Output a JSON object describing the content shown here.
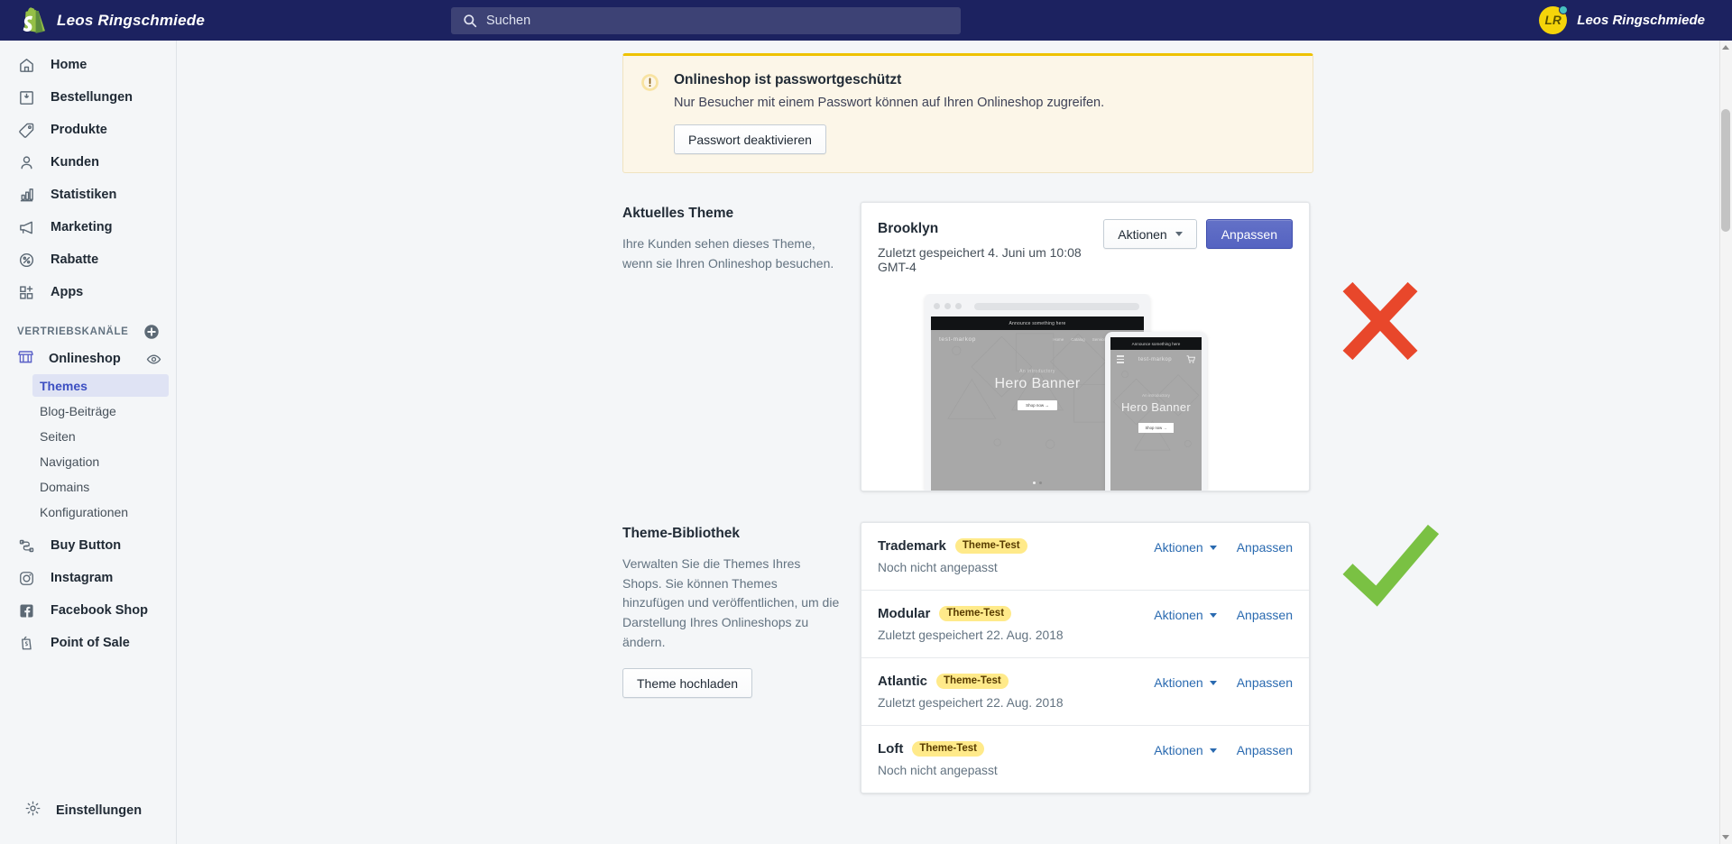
{
  "topbar": {
    "brand_name": "Leos Ringschmiede",
    "search_placeholder": "Suchen",
    "user_name": "Leos Ringschmiede",
    "avatar_initials": "LR",
    "accent_navy": "#1c2260",
    "avatar_bg": "#f5d40a",
    "notification_dot": "#47c1bf"
  },
  "sidebar": {
    "items": [
      {
        "label": "Home",
        "icon": "home-icon"
      },
      {
        "label": "Bestellungen",
        "icon": "orders-icon"
      },
      {
        "label": "Produkte",
        "icon": "products-tag-icon"
      },
      {
        "label": "Kunden",
        "icon": "customers-person-icon"
      },
      {
        "label": "Statistiken",
        "icon": "analytics-bars-icon"
      },
      {
        "label": "Marketing",
        "icon": "marketing-megaphone-icon"
      },
      {
        "label": "Rabatte",
        "icon": "discounts-percent-icon"
      },
      {
        "label": "Apps",
        "icon": "apps-grid-icon"
      }
    ],
    "channels_heading": "VERTRIEBSKANÄLE",
    "add_channel_icon": "plus-circle-icon",
    "online_store": {
      "label": "Onlineshop",
      "icon": "storefront-icon",
      "view_icon": "eye-icon"
    },
    "subitems": [
      {
        "label": "Themes",
        "active": true
      },
      {
        "label": "Blog-Beiträge",
        "active": false
      },
      {
        "label": "Seiten",
        "active": false
      },
      {
        "label": "Navigation",
        "active": false
      },
      {
        "label": "Domains",
        "active": false
      },
      {
        "label": "Konfigurationen",
        "active": false
      }
    ],
    "channels": [
      {
        "label": "Buy Button",
        "icon": "buy-button-icon"
      },
      {
        "label": "Instagram",
        "icon": "instagram-icon"
      },
      {
        "label": "Facebook Shop",
        "icon": "facebook-icon"
      },
      {
        "label": "Point of Sale",
        "icon": "pos-icon"
      }
    ],
    "settings": {
      "label": "Einstellungen",
      "icon": "gear-icon"
    }
  },
  "banner": {
    "icon": "alert-circle-icon",
    "title": "Onlineshop ist passwortgeschützt",
    "text": "Nur Besucher mit einem Passwort können auf Ihren Onlineshop zugreifen.",
    "button": "Passwort deaktivieren",
    "border_color": "#eec200",
    "bg_color": "#fcf6e8"
  },
  "current_theme": {
    "heading": "Aktuelles Theme",
    "description": "Ihre Kunden sehen dieses Theme, wenn sie Ihren Onlineshop besuchen.",
    "name": "Brooklyn",
    "saved": "Zuletzt gespeichert 4. Juni um 10:08 GMT-4",
    "actions_label": "Aktionen",
    "customize_label": "Anpassen",
    "primary_color": "#5563c1",
    "preview": {
      "announce": "Announce something here",
      "logo": "test-markop",
      "nav": [
        "Home",
        "Catalog",
        "Services"
      ],
      "search_icon": "search-icon",
      "cart_icon": "cart-icon",
      "kicker": "An introductory",
      "title": "Hero Banner",
      "cta": "Shop now →",
      "menu_icon": "hamburger-icon"
    }
  },
  "theme_library": {
    "heading": "Theme-Bibliothek",
    "description": "Verwalten Sie die Themes Ihres Shops. Sie können Themes hinzufügen und veröffentlichen, um die Darstellung Ihres Onlineshops zu ändern.",
    "upload_button": "Theme hochladen",
    "actions_label": "Aktionen",
    "customize_label": "Anpassen",
    "badge_color": "#ffea8a",
    "link_color": "#2a6ab0",
    "rows": [
      {
        "name": "Trademark",
        "badge": "Theme-Test",
        "status": "Noch nicht angepasst"
      },
      {
        "name": "Modular",
        "badge": "Theme-Test",
        "status": "Zuletzt gespeichert 22. Aug. 2018"
      },
      {
        "name": "Atlantic",
        "badge": "Theme-Test",
        "status": "Zuletzt gespeichert 22. Aug. 2018"
      },
      {
        "name": "Loft",
        "badge": "Theme-Test",
        "status": "Noch nicht angepasst"
      }
    ]
  },
  "annotations": [
    {
      "name": "red-x-mark",
      "symbol": "×",
      "color": "#e8472b"
    },
    {
      "name": "green-check-mark",
      "symbol": "✓",
      "color": "#7ac143"
    }
  ]
}
